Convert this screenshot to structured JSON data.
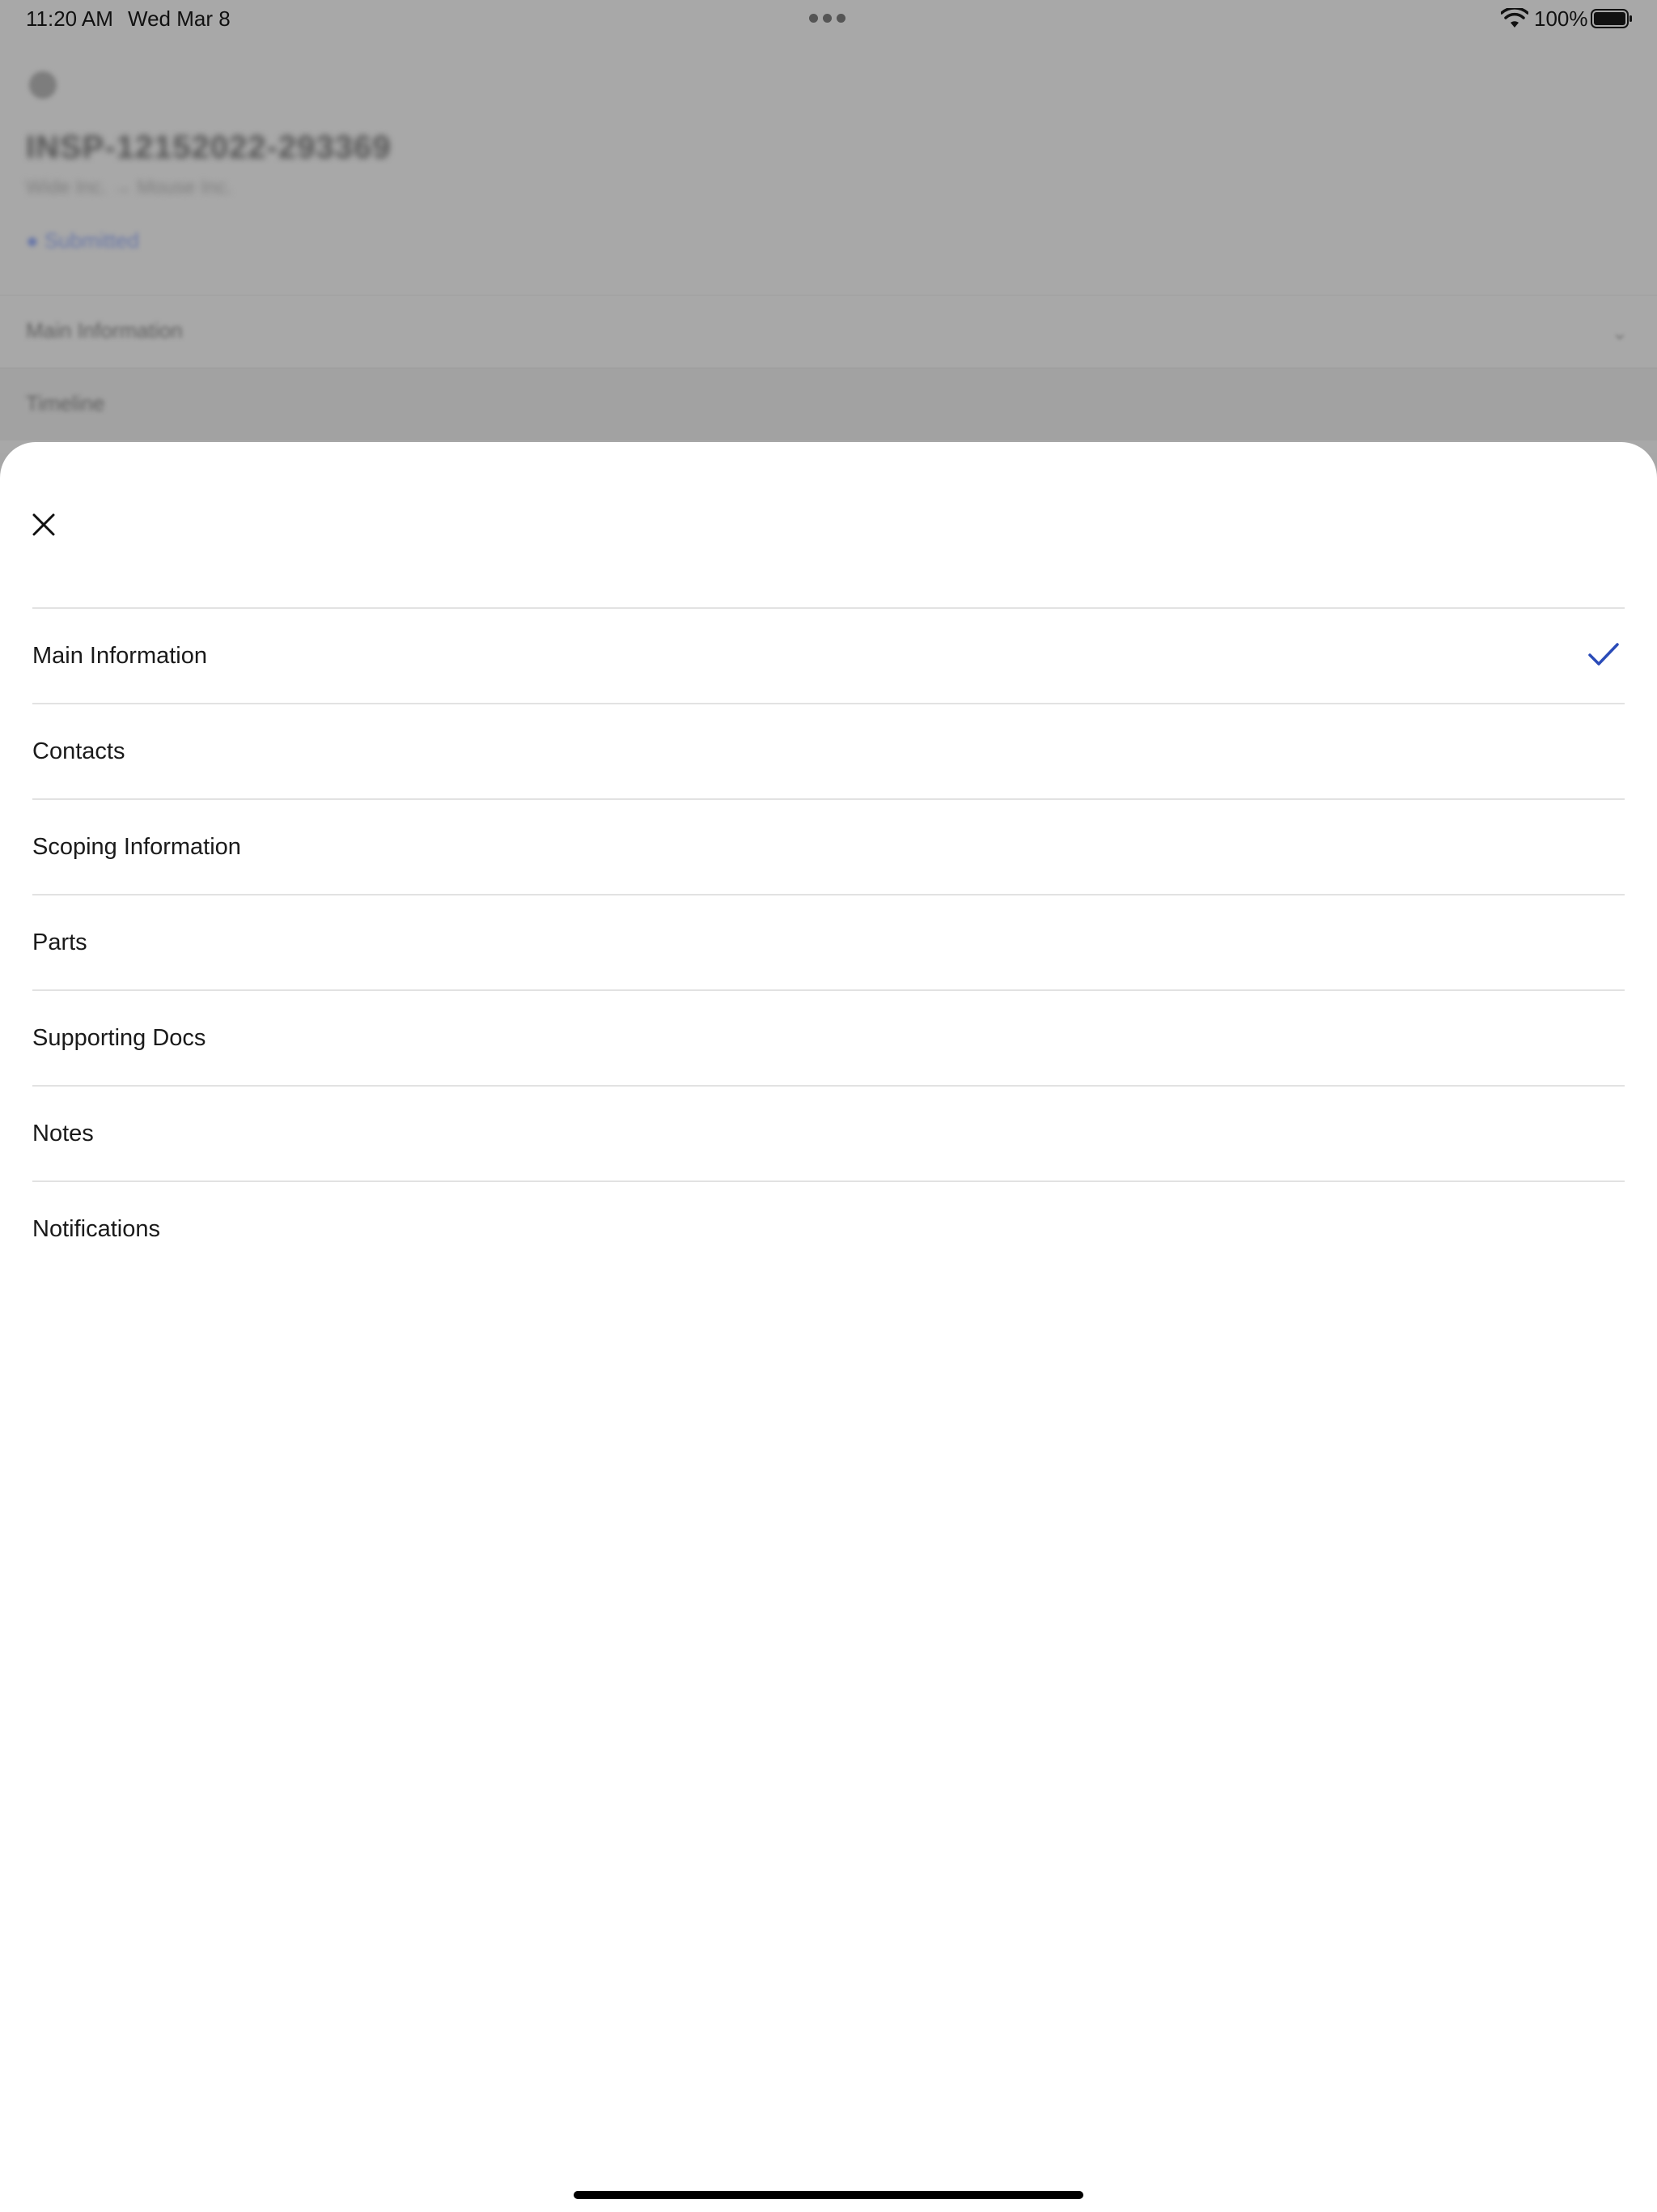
{
  "status_bar": {
    "time": "11:20 AM",
    "date": "Wed Mar 8",
    "battery": "100%"
  },
  "background": {
    "title": "INSP-12152022-293369",
    "subtitle": "Wide Inc. → Mouse Inc.",
    "status": "● Submitted",
    "rows": [
      {
        "label": "Main Information",
        "chevron": "⌄"
      },
      {
        "label": "Timeline"
      }
    ]
  },
  "sheet": {
    "items": [
      {
        "label": "Main Information",
        "selected": true
      },
      {
        "label": "Contacts",
        "selected": false
      },
      {
        "label": "Scoping Information",
        "selected": false
      },
      {
        "label": "Parts",
        "selected": false
      },
      {
        "label": "Supporting Docs",
        "selected": false
      },
      {
        "label": "Notes",
        "selected": false
      },
      {
        "label": "Notifications",
        "selected": false
      }
    ]
  },
  "colors": {
    "accent": "#2a4bb8",
    "dim_background": "#a8a8a8"
  },
  "icons": {
    "close": "close-icon",
    "check": "checkmark-icon",
    "wifi": "wifi-icon",
    "battery": "battery-icon"
  }
}
